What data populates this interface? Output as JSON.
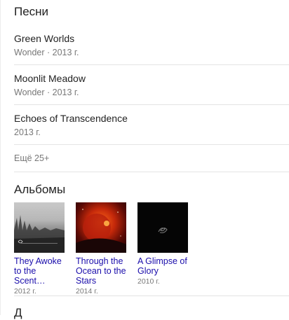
{
  "songs_section": {
    "heading": "Песни",
    "items": [
      {
        "title": "Green Worlds",
        "subtitle": "Wonder · 2013 г."
      },
      {
        "title": "Moonlit Meadow",
        "subtitle": "Wonder · 2013 г."
      },
      {
        "title": "Echoes of Transcendence",
        "subtitle": "2013 г."
      }
    ],
    "more_label": "Ещё 25+"
  },
  "albums_section": {
    "heading": "Альбомы",
    "items": [
      {
        "title": "They Awoke to the Scent…",
        "year": "2012 г."
      },
      {
        "title": "Through the Ocean to the Stars",
        "year": "2014 г."
      },
      {
        "title": "A Glimpse of Glory",
        "year": "2010 г."
      }
    ]
  },
  "next_section": {
    "heading": "Д"
  },
  "colors": {
    "link": "#1a0dab",
    "text": "#222222",
    "secondary": "#777777",
    "divider": "#e4e4e4"
  },
  "icons": [
    "forest-cover-art",
    "red-planet-cover-art",
    "dark-symbol-cover-art"
  ]
}
